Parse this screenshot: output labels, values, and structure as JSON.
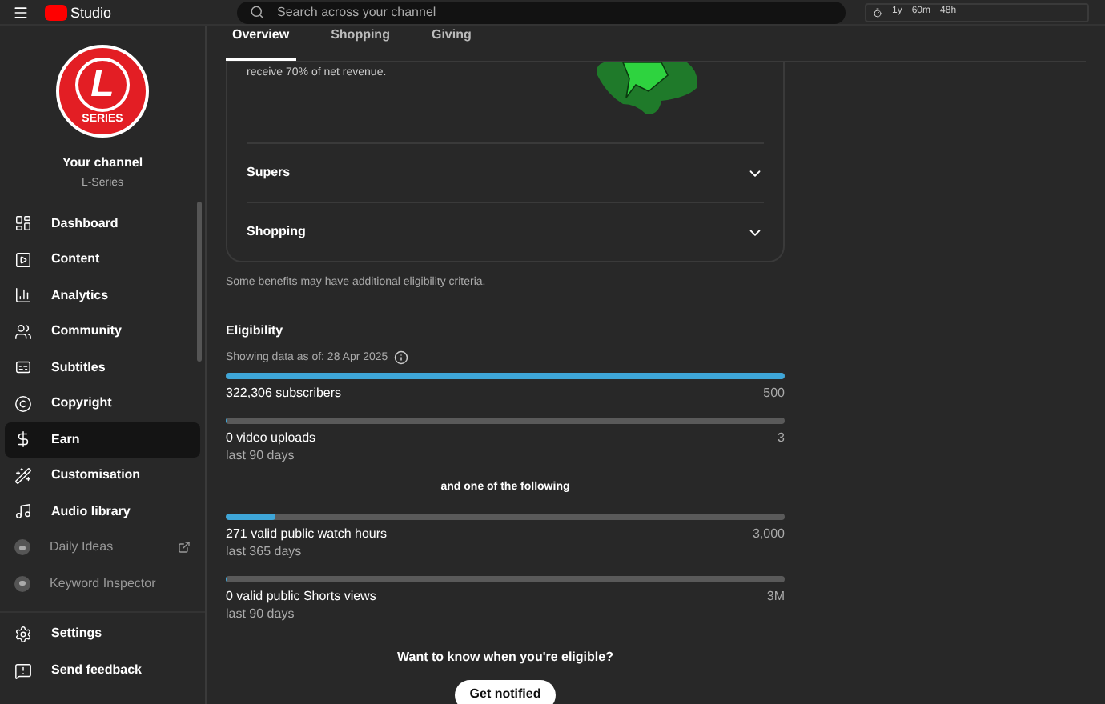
{
  "topbar": {
    "logo": "Studio",
    "search": {
      "placeholder": "Search across your channel"
    },
    "widget": [
      "1y",
      "60m",
      "48h"
    ]
  },
  "sidebar": {
    "channel_title": "Your channel",
    "channel_name": "L-Series",
    "avatar_letter": "L",
    "avatar_caption": "SERIES",
    "items": [
      {
        "label": "Dashboard",
        "kind": "nav",
        "selected": false
      },
      {
        "label": "Content",
        "kind": "nav",
        "selected": false
      },
      {
        "label": "Analytics",
        "kind": "nav",
        "selected": false
      },
      {
        "label": "Community",
        "kind": "nav",
        "selected": false
      },
      {
        "label": "Subtitles",
        "kind": "nav",
        "selected": false
      },
      {
        "label": "Copyright",
        "kind": "nav",
        "selected": false
      },
      {
        "label": "Earn",
        "kind": "nav",
        "selected": true
      },
      {
        "label": "Customisation",
        "kind": "nav",
        "selected": false
      },
      {
        "label": "Audio library",
        "kind": "nav",
        "selected": false
      },
      {
        "label": "Daily Ideas",
        "kind": "extension",
        "selected": false
      },
      {
        "label": "Keyword Inspector",
        "kind": "extension",
        "selected": false
      }
    ],
    "bottom_items": [
      {
        "label": "Settings"
      },
      {
        "label": "Send feedback"
      }
    ]
  },
  "tabs": [
    {
      "label": "Overview",
      "selected": true
    },
    {
      "label": "Shopping",
      "selected": false
    },
    {
      "label": "Giving",
      "selected": false
    }
  ],
  "card": {
    "text": "receive 70% of net revenue.",
    "sections": [
      {
        "title": "Supers",
        "expanded": false
      },
      {
        "title": "Shopping",
        "expanded": false
      }
    ]
  },
  "note": "Some benefits may have additional eligibility criteria.",
  "eligibility": {
    "title": "Eligibility",
    "as_of": "Showing data as of: 28 Apr 2025",
    "separator": "and one of the following",
    "requirements": [
      {
        "label": "322,306 subscribers",
        "target": "500",
        "level": 1
      },
      {
        "label": "0 video uploads",
        "period": "last 90 days",
        "target": "3",
        "level": 0
      },
      {
        "label": "271 valid public watch hours",
        "period": "last 365 days",
        "target": "3,000",
        "level": 0.09
      },
      {
        "label": "0 valid public Shorts views",
        "period": "last 90 days",
        "target": "3M",
        "level": 0
      }
    ]
  },
  "cta": {
    "question": "Want to know when you're eligible?",
    "button": "Get notified"
  }
}
